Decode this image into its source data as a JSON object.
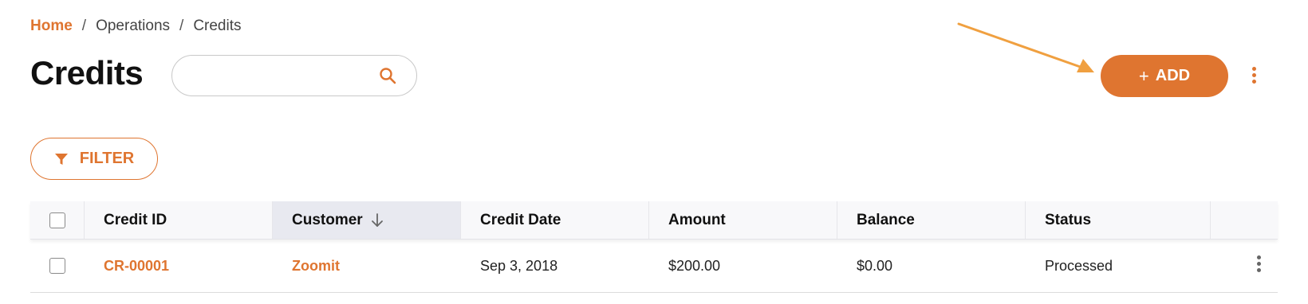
{
  "breadcrumb": {
    "home": "Home",
    "separator": "/",
    "items": [
      "Operations",
      "Credits"
    ]
  },
  "page": {
    "title": "Credits"
  },
  "search": {
    "placeholder": "",
    "value": ""
  },
  "toolbar": {
    "add_plus": "+",
    "add_label": "ADD",
    "filter_label": "FILTER",
    "more_icon": "more-vertical-icon"
  },
  "colors": {
    "accent": "#df7530",
    "header_bg": "#f8f8fa",
    "sorted_header_bg": "#e8e9f0",
    "annotation_arrow": "#f0a040"
  },
  "table": {
    "columns": [
      {
        "label": "Credit ID"
      },
      {
        "label": "Customer",
        "sort": "descending"
      },
      {
        "label": "Credit Date"
      },
      {
        "label": "Amount"
      },
      {
        "label": "Balance"
      },
      {
        "label": "Status"
      }
    ],
    "rows": [
      {
        "credit_id": "CR-00001",
        "customer": "Zoomit",
        "credit_date": "Sep 3, 2018",
        "amount": "$200.00",
        "balance": "$0.00",
        "status": "Processed"
      }
    ]
  }
}
